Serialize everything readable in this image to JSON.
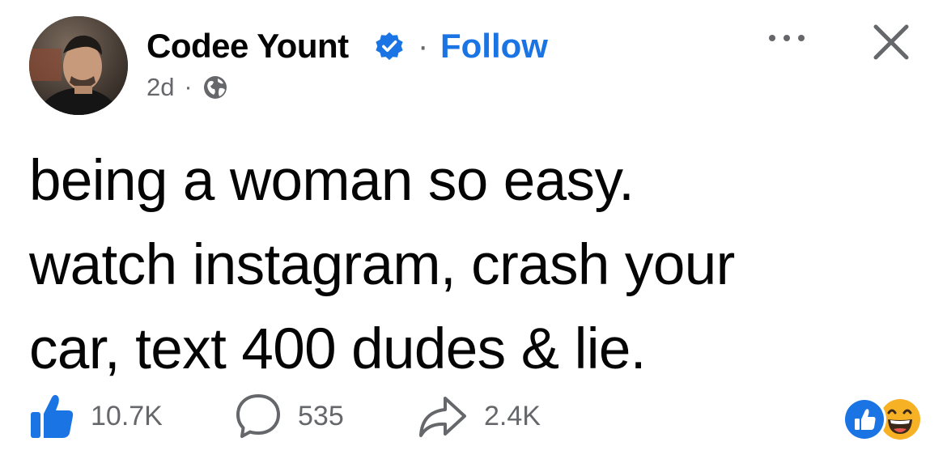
{
  "post": {
    "author_name": "Codee Yount",
    "separator": "·",
    "follow_label": "Follow",
    "age": "2d",
    "meta_separator": "·",
    "audience_icon": "globe-icon",
    "lines": [
      "being a woman so easy.",
      "watch instagram, crash your",
      "car, text 400 dudes & lie."
    ]
  },
  "stats": {
    "likes": "10.7K",
    "comments": "535",
    "shares": "2.4K"
  },
  "colors": {
    "brand_blue": "#1b74e4",
    "secondary_text": "#65676b",
    "primary_text": "#050505",
    "haha_yellow": "#f7b125"
  },
  "icons": {
    "verified": "verified-badge-icon",
    "more": "more-options-icon",
    "close": "close-icon",
    "like": "thumbs-up-icon",
    "comment": "comment-bubble-icon",
    "share": "share-arrow-icon",
    "reaction_like": "like-reaction-icon",
    "reaction_haha": "haha-reaction-icon"
  }
}
